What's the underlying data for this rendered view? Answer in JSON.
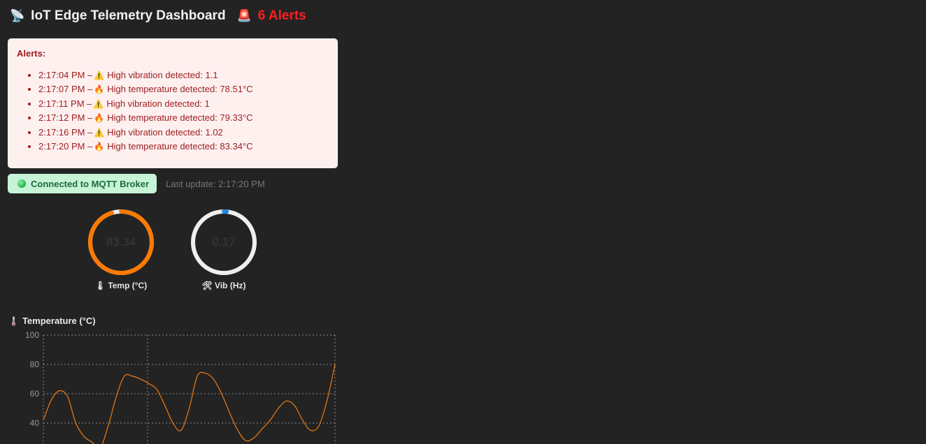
{
  "header": {
    "title": "IoT Edge Telemetry Dashboard",
    "title_icon": "satellite-antenna-icon",
    "alert_icon": "police-light-icon",
    "alert_count_text": "6 Alerts"
  },
  "alerts": {
    "heading": "Alerts:",
    "items": [
      {
        "time": "2:17:04 PM –",
        "symbol": "⚠️",
        "icon": "warning-icon",
        "message": "High vibration detected: 1.1"
      },
      {
        "time": "2:17:07 PM –",
        "symbol": "🔥",
        "icon": "fire-icon",
        "message": "High temperature detected: 78.51°C"
      },
      {
        "time": "2:17:11 PM –",
        "symbol": "⚠️",
        "icon": "warning-icon",
        "message": "High vibration detected: 1"
      },
      {
        "time": "2:17:12 PM –",
        "symbol": "🔥",
        "icon": "fire-icon",
        "message": "High temperature detected: 79.33°C"
      },
      {
        "time": "2:17:16 PM –",
        "symbol": "⚠️",
        "icon": "warning-icon",
        "message": "High vibration detected: 1.02"
      },
      {
        "time": "2:17:20 PM –",
        "symbol": "🔥",
        "icon": "fire-icon",
        "message": "High temperature detected: 83.34°C"
      }
    ]
  },
  "status": {
    "connection": "Connected to MQTT Broker",
    "last_update": "Last update: 2:17:20 PM"
  },
  "gauges": {
    "temp": {
      "value": "83.34",
      "label": "🌡 Temp (°C)",
      "fill_fraction": 0.95,
      "color": "#ff7a00"
    },
    "vib": {
      "value": "0.17",
      "label": "🛠 Vib (Hz)",
      "fill_fraction": 0.015,
      "color": "#1e88e5"
    }
  },
  "colors": {
    "background": "#232323",
    "alert_red": "#ff1e1e",
    "alerts_bg": "#fff0f0",
    "connected_bg": "#c7f3d7",
    "line": "#e07416",
    "track": "#efefef"
  },
  "temperature_chart": {
    "title": "Temperature (°C)",
    "title_icon": "thermometer-icon"
  },
  "chart_data": {
    "type": "line",
    "title": "Temperature (°C)",
    "ylim": [
      20,
      100
    ],
    "yticks": [
      "100",
      "80",
      "60",
      "40"
    ],
    "grid": true,
    "series": [
      {
        "values": [
          42,
          56,
          62,
          58,
          40,
          31,
          27,
          23,
          38,
          58,
          72,
          72,
          70,
          67,
          63,
          52,
          40,
          35,
          50,
          72,
          74,
          70,
          60,
          47,
          35,
          28,
          30,
          36,
          42,
          50,
          55,
          52,
          42,
          35,
          38,
          55,
          80
        ]
      }
    ]
  }
}
